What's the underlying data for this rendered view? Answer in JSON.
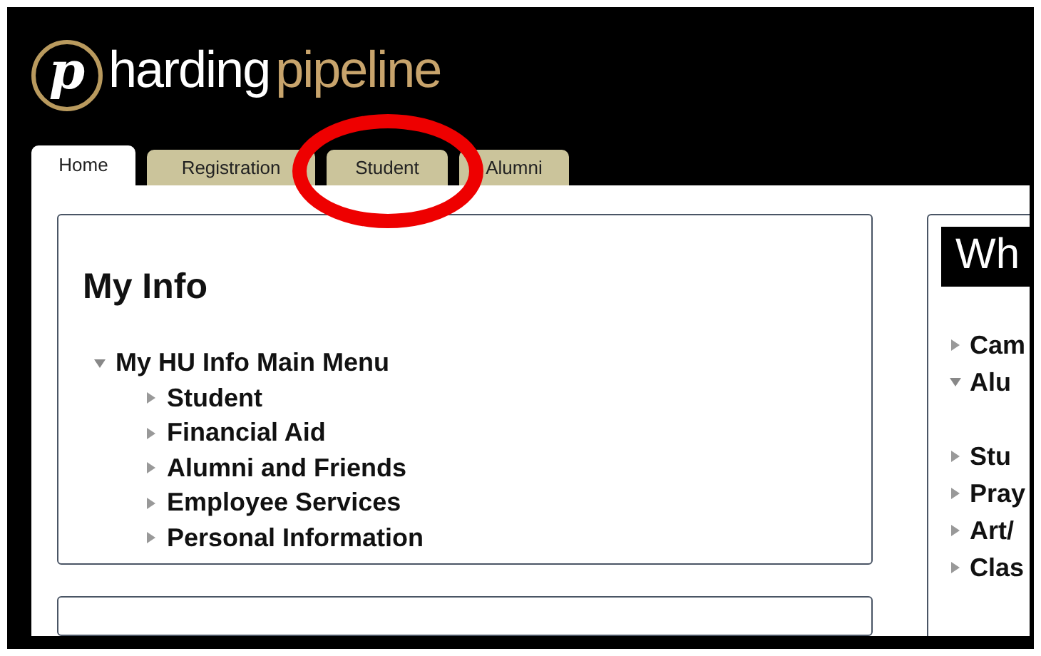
{
  "logo": {
    "mark": "p",
    "word_1": "harding",
    "word_2": "pipeline"
  },
  "tabs": [
    {
      "label": "Home",
      "selected": true
    },
    {
      "label": "Registration",
      "selected": false
    },
    {
      "label": "Student",
      "selected": false
    },
    {
      "label": "Alumni",
      "selected": false
    }
  ],
  "my_info": {
    "title": "My Info",
    "menu": [
      {
        "label": "My HU Info Main Menu",
        "expanded": true,
        "children": [
          {
            "label": "Student",
            "expanded": false
          },
          {
            "label": "Financial Aid",
            "expanded": false
          },
          {
            "label": "Alumni and Friends",
            "expanded": false
          },
          {
            "label": "Employee Services",
            "expanded": false
          },
          {
            "label": "Personal Information",
            "expanded": false
          }
        ]
      }
    ]
  },
  "right_panel": {
    "title": "Wh",
    "items": [
      {
        "label": "Cam",
        "expanded": false
      },
      {
        "label": "Alu",
        "expanded": true
      },
      {
        "label": "Stu",
        "expanded": false
      },
      {
        "label": "Pray",
        "expanded": false
      },
      {
        "label": "Art/",
        "expanded": false
      },
      {
        "label": "Clas",
        "expanded": false
      }
    ]
  },
  "annotation": {
    "kind": "circle"
  }
}
